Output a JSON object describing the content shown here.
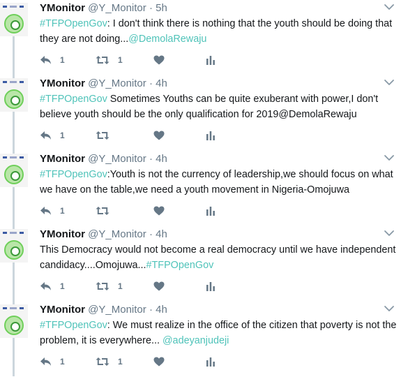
{
  "colors": {
    "accent": "#4fc3b9",
    "muted": "#657786",
    "text": "#14171a",
    "thread": "#ccd6dd"
  },
  "tweets": [
    {
      "name": "YMonitor",
      "handle": "@Y_Monitor",
      "separator": "·",
      "time": "5h",
      "parts": [
        {
          "type": "hashtag",
          "text": "#TFPOpenGov"
        },
        {
          "type": "text",
          "text": ": I don't think there is nothing that the youth  should be doing that they are not doing..."
        },
        {
          "type": "mention",
          "text": "@DemolaRewaju"
        }
      ],
      "reply_count": "1",
      "retweet_count": "1",
      "like_count": ""
    },
    {
      "name": "YMonitor",
      "handle": "@Y_Monitor",
      "separator": "·",
      "time": "4h",
      "parts": [
        {
          "type": "hashtag",
          "text": "#TFPOpenGov"
        },
        {
          "type": "text",
          "text": " Sometimes Youths can be quite exuberant with power,I don't believe youth should be the only qualification for 2019@DemolaRewaju"
        }
      ],
      "reply_count": "1",
      "retweet_count": "",
      "like_count": ""
    },
    {
      "name": "YMonitor",
      "handle": "@Y_Monitor",
      "separator": "·",
      "time": "4h",
      "parts": [
        {
          "type": "hashtag",
          "text": "#TFPOpenGov"
        },
        {
          "type": "text",
          "text": ":Youth is not the currency of leadership,we should focus on what we have on the table,we need a youth movement in Nigeria-Omojuwa"
        }
      ],
      "reply_count": "1",
      "retweet_count": "",
      "like_count": ""
    },
    {
      "name": "YMonitor",
      "handle": "@Y_Monitor",
      "separator": "·",
      "time": "4h",
      "parts": [
        {
          "type": "text",
          "text": "This Democracy would not become a real democracy until we have independent candidacy....Omojuwa..."
        },
        {
          "type": "hashtag",
          "text": "#TFPOpenGov"
        }
      ],
      "reply_count": "1",
      "retweet_count": "1",
      "like_count": ""
    },
    {
      "name": "YMonitor",
      "handle": "@Y_Monitor",
      "separator": "·",
      "time": "4h",
      "parts": [
        {
          "type": "hashtag",
          "text": "#TFPOpenGov"
        },
        {
          "type": "text",
          "text": ": We must realize in the office of the citizen that poverty is not the problem, it is everywhere... "
        },
        {
          "type": "mention",
          "text": "@adeyanjudeji"
        }
      ],
      "reply_count": "1",
      "retweet_count": "1",
      "like_count": ""
    }
  ]
}
